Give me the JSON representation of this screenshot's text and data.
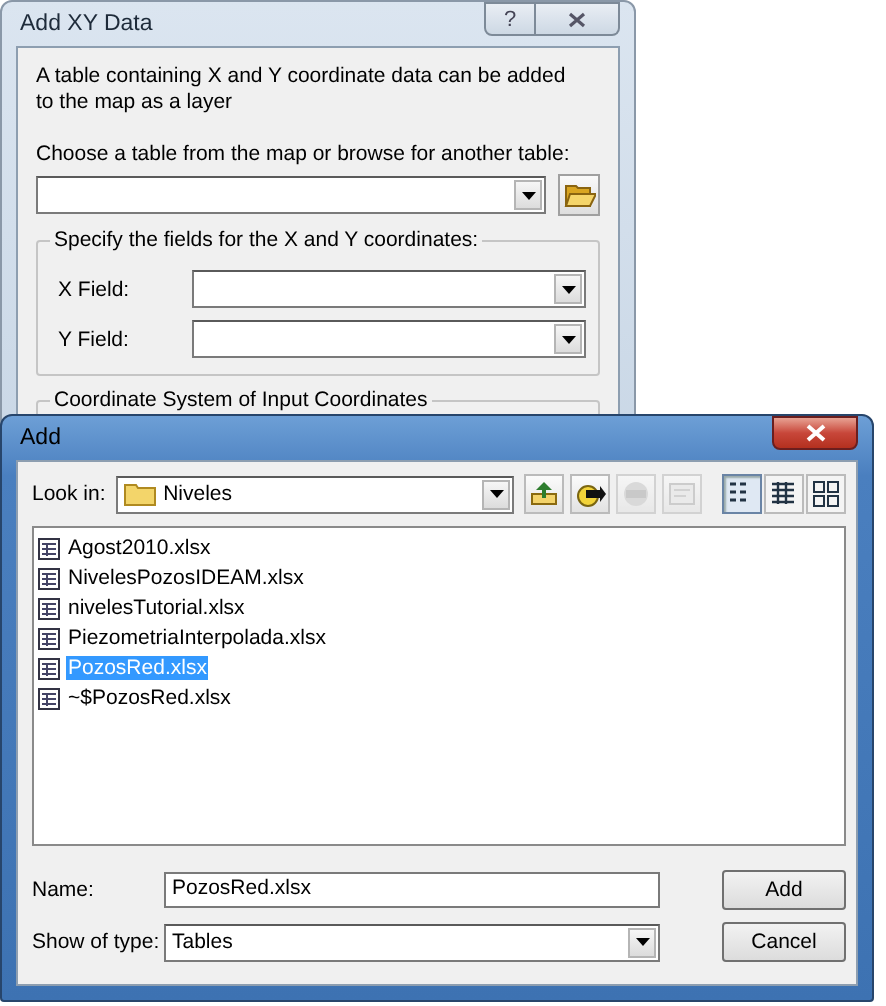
{
  "xy_window": {
    "title": "Add XY Data",
    "help_button": "?",
    "description": "A table containing X and Y coordinate data can be added to the map as a layer",
    "table_label": "Choose a table from the map or browse for another table:",
    "fields_group": {
      "title": "Specify the fields for the X and Y coordinates:",
      "fields": [
        {
          "label": "X Field:"
        },
        {
          "label": "Y Field:"
        }
      ]
    },
    "coordinate_group": {
      "title": "Coordinate System of Input Coordinates"
    }
  },
  "add_window": {
    "title": "Add",
    "look_in_label": "Look in:",
    "look_in_value": "Niveles",
    "toolbar": [
      {
        "kind": "up",
        "disabled": false
      },
      {
        "kind": "connect",
        "disabled": false
      },
      {
        "kind": "disconnect",
        "disabled": true
      },
      {
        "kind": "properties",
        "disabled": true
      }
    ],
    "views": [
      {
        "kind": "list",
        "selected": true
      },
      {
        "kind": "details",
        "selected": false
      },
      {
        "kind": "thumbnails",
        "selected": false
      }
    ],
    "files": [
      {
        "name": "Agost2010.xlsx",
        "selected": false
      },
      {
        "name": "NivelesPozosIDEAM.xlsx",
        "selected": false
      },
      {
        "name": "nivelesTutorial.xlsx",
        "selected": false
      },
      {
        "name": "PiezometriaInterpolada.xlsx",
        "selected": false
      },
      {
        "name": "PozosRed.xlsx",
        "selected": true
      },
      {
        "name": "~$PozosRed.xlsx",
        "selected": false
      }
    ],
    "name_label": "Name:",
    "name_value": "PozosRed.xlsx",
    "type_label": "Show of type:",
    "type_value": "Tables",
    "buttons": [
      "Add",
      "Cancel"
    ]
  }
}
